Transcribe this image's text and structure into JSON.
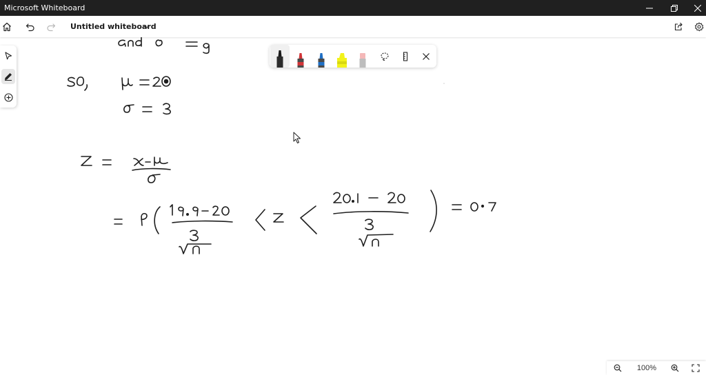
{
  "window": {
    "title": "Microsoft Whiteboard",
    "minimize_icon": "minimize-icon",
    "maximize_icon": "restore-icon",
    "close_icon": "close-icon"
  },
  "appbar": {
    "document_name": "Untitled whiteboard",
    "icons": [
      "home-icon",
      "undo-icon",
      "redo-icon",
      "chevron-down-icon",
      "share-icon",
      "settings-icon"
    ]
  },
  "left_toolbar": {
    "icons": [
      "select-arrow-icon",
      "pen-icon",
      "add-icon"
    ],
    "active": "pen-icon"
  },
  "pen_tray": {
    "tools": [
      {
        "name": "black-pen",
        "color": "#1a1a1a"
      },
      {
        "name": "red-pen",
        "color": "#d13438"
      },
      {
        "name": "blue-pen",
        "color": "#1f6fc4"
      },
      {
        "name": "yellow-highlighter",
        "color": "#f2f21a"
      },
      {
        "name": "eraser",
        "color": "#f4b8b8"
      }
    ],
    "selected": "black-pen",
    "icons": [
      "lasso-icon",
      "ruler-icon",
      "close-icon"
    ]
  },
  "zoom": {
    "level": "100%",
    "icons": [
      "zoom-out-icon",
      "zoom-in-icon",
      "fit-to-screen-icon"
    ]
  },
  "ink_color": "#1e1e1e",
  "handwriting": {
    "line1": "and σ = 9",
    "line2": "so, μ = 20",
    "line3": "σ = 3",
    "line4": "z = (x − μ) / σ",
    "line5": "= P( (19.9 − 20)/(3/√n) < z < (20.1 − 20)/(3/√n) ) = 0.7"
  }
}
